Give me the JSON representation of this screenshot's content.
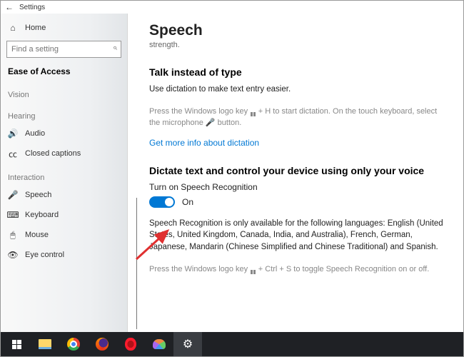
{
  "titlebar": {
    "title": "Settings"
  },
  "sidebar": {
    "home": "Home",
    "search_placeholder": "Find a setting",
    "group": "Ease of Access",
    "sections": {
      "vision": "Vision",
      "hearing": "Hearing",
      "interaction": "Interaction"
    },
    "items": {
      "audio": "Audio",
      "closed_captions": "Closed captions",
      "speech": "Speech",
      "keyboard": "Keyboard",
      "mouse": "Mouse",
      "eye_control": "Eye control"
    }
  },
  "content": {
    "title": "Speech",
    "subtitle": "strength.",
    "section1_heading": "Talk instead of type",
    "section1_para": "Use dictation to make text entry easier.",
    "hint1_pre": "Press the Windows logo key ",
    "hint1_mid": " + H to start dictation.  On the touch keyboard, select the microphone ",
    "hint1_post": " button.",
    "link": "Get more info about dictation",
    "section2_heading": "Dictate text and control your device using only your voice",
    "toggle_label": "Turn on Speech Recognition",
    "toggle_state": "On",
    "availability": "Speech Recognition is only available for the following languages: English (United States, United Kingdom, Canada, India, and Australia), French, German, Japanese, Mandarin (Chinese Simplified and Chinese Traditional) and Spanish.",
    "hint2_pre": "Press the Windows logo key ",
    "hint2_post": " + Ctrl + S to toggle Speech Recognition on or off."
  }
}
